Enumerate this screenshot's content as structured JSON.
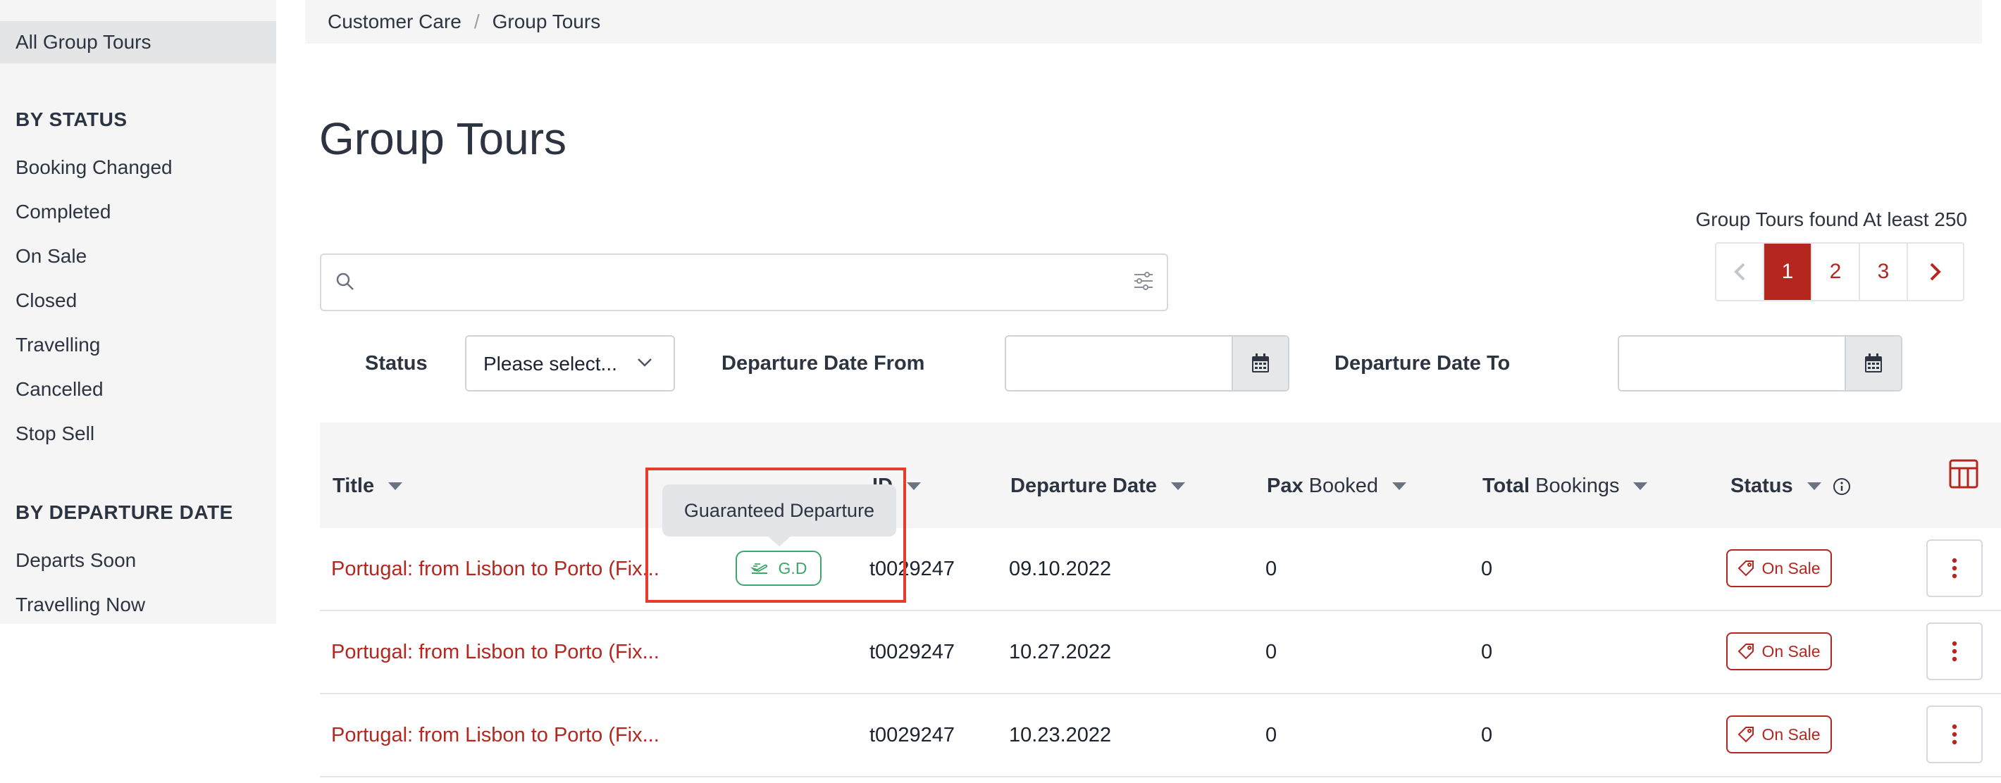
{
  "sidebar": {
    "active_item": "All Group Tours",
    "status_heading": "BY STATUS",
    "status_items": [
      "Booking Changed",
      "Completed",
      "On Sale",
      "Closed",
      "Travelling",
      "Cancelled",
      "Stop Sell"
    ],
    "date_heading": "BY DEPARTURE DATE",
    "date_items": [
      "Departs Soon",
      "Travelling Now"
    ]
  },
  "breadcrumb": {
    "items": [
      "Customer Care",
      "Group Tours"
    ],
    "separator": "/"
  },
  "page": {
    "title": "Group Tours",
    "found_text": "Group Tours found At least 250"
  },
  "pagination": {
    "pages": [
      "1",
      "2",
      "3"
    ],
    "current": "1"
  },
  "search": {
    "value": "",
    "placeholder": ""
  },
  "filters": {
    "status_label": "Status",
    "status_value": "Please select...",
    "date_from_label": "Departure Date From",
    "date_from_value": "",
    "date_to_label": "Departure Date To",
    "date_to_value": ""
  },
  "table": {
    "columns": {
      "title": "Title",
      "id": "ID",
      "departure_date": "Departure Date",
      "pax_bold": "Pax",
      "pax_rest": " Booked",
      "total_bold": "Total",
      "total_rest": " Bookings",
      "status": "Status"
    },
    "rows": [
      {
        "title": "Portugal: from Lisbon to Porto (Fix...",
        "badge": "G.D",
        "id": "t0029247",
        "departure": "09.10.2022",
        "pax": "0",
        "total": "0",
        "status": "On Sale"
      },
      {
        "title": "Portugal: from Lisbon to Porto (Fix...",
        "badge": "",
        "id": "t0029247",
        "departure": "10.27.2022",
        "pax": "0",
        "total": "0",
        "status": "On Sale"
      },
      {
        "title": "Portugal: from Lisbon to Porto (Fix...",
        "badge": "",
        "id": "t0029247",
        "departure": "10.23.2022",
        "pax": "0",
        "total": "0",
        "status": "On Sale"
      }
    ]
  },
  "tooltip": {
    "text": "Guaranteed Departure"
  },
  "colors": {
    "brand_red": "#b5261e",
    "guaranteed_green": "#3fa66a",
    "highlight_red": "#e53c2d"
  },
  "icons": {
    "search": "search-icon",
    "filter": "sliders-icon",
    "calendar": "calendar-icon",
    "tag": "tag-icon",
    "kebab": "kebab-icon",
    "columns": "table-columns-icon",
    "info": "info-icon"
  }
}
